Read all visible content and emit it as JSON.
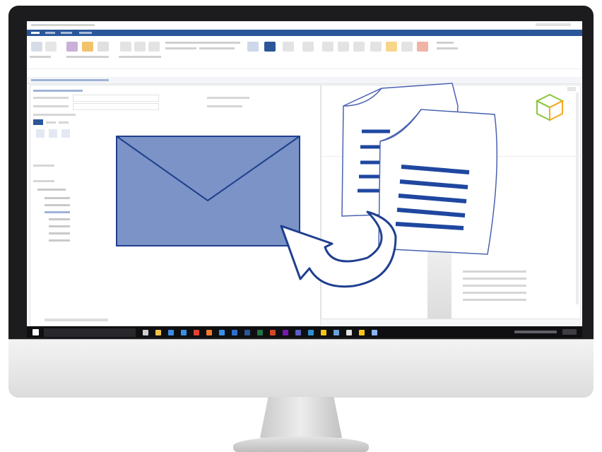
{
  "taskbar": {
    "icons": [
      {
        "name": "task-view-icon",
        "color": "#cfcfcf"
      },
      {
        "name": "explorer-icon",
        "color": "#f0c24b"
      },
      {
        "name": "edge-icon",
        "color": "#3a8ee6"
      },
      {
        "name": "store-icon",
        "color": "#3a8ee6"
      },
      {
        "name": "chrome-icon",
        "color": "#e34133"
      },
      {
        "name": "firefox-icon",
        "color": "#f37b2b"
      },
      {
        "name": "mail-icon",
        "color": "#3a8ee6"
      },
      {
        "name": "outlook-icon",
        "color": "#2f6fd1"
      },
      {
        "name": "word-icon",
        "color": "#2b579a"
      },
      {
        "name": "excel-icon",
        "color": "#217346"
      },
      {
        "name": "powerpoint-icon",
        "color": "#d24726"
      },
      {
        "name": "onenote-icon",
        "color": "#7719aa"
      },
      {
        "name": "teams-icon",
        "color": "#5b5fc7"
      },
      {
        "name": "photos-icon",
        "color": "#2f8fd1"
      },
      {
        "name": "notes-icon",
        "color": "#f5c518"
      },
      {
        "name": "app-icon",
        "color": "#6a9fd8"
      },
      {
        "name": "app2-icon",
        "color": "#e2e2e2"
      },
      {
        "name": "warning-icon",
        "color": "#f5c518"
      },
      {
        "name": "active-app-icon",
        "color": "#8ab4f8"
      }
    ]
  },
  "colors": {
    "accent": "#2b579a",
    "envelope_fill": "#7b93c6",
    "envelope_stroke": "#1f3f8f",
    "doc_lines": "#1f47a0",
    "doc_outline": "#4a63b0",
    "cube_green": "#8cc63f",
    "cube_orange": "#f7a823"
  }
}
